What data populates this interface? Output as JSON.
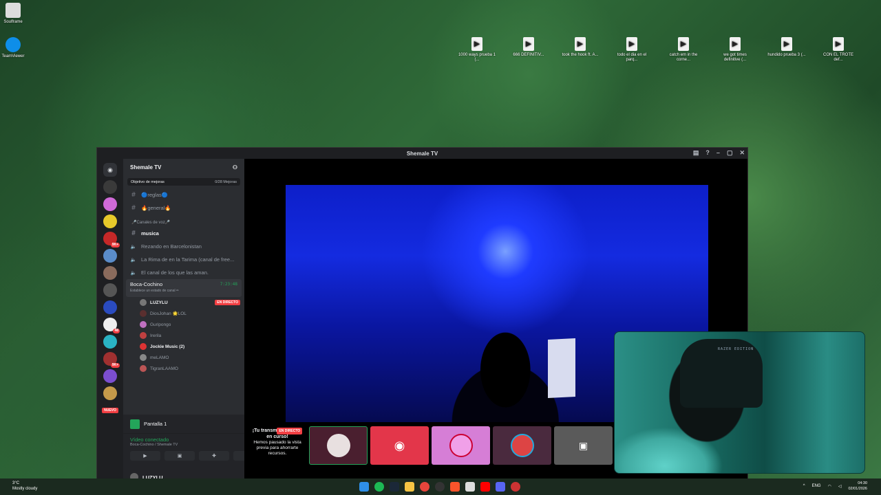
{
  "desktop": {
    "left_icons": [
      {
        "label": "Soulframe"
      },
      {
        "label": "TeamViewer"
      }
    ],
    "files": [
      {
        "label": "1000 ways prueba 1 (..."
      },
      {
        "label": "666 DEFINITIV..."
      },
      {
        "label": "took the hook ft. A..."
      },
      {
        "label": "todo el dia en el parq..."
      },
      {
        "label": "catch em in the corne..."
      },
      {
        "label": "we got times definitive (..."
      },
      {
        "label": "hundido prueba 3 (..."
      },
      {
        "label": "CON EL TROTE def..."
      }
    ]
  },
  "window": {
    "title": "Shemale TV"
  },
  "server": {
    "name": "Shemale TV",
    "boost_label": "Objetivo de mejoras",
    "boost_progress": "0/28 Mejoras",
    "server_badges": [
      "",
      "",
      "",
      "9K+",
      "",
      "",
      "",
      "",
      "",
      "48",
      "",
      "9K+",
      "",
      "56",
      "9"
    ],
    "new_label": "NUEVO"
  },
  "channels": {
    "text": [
      {
        "name": "🔵reglas🔵"
      },
      {
        "name": "🔥general🔥"
      }
    ],
    "voice_category": "🎤Canales de voz🎤",
    "voice": [
      {
        "name": "musica",
        "bright": true
      },
      {
        "name": "Rezando en Barcelonistan"
      },
      {
        "name": "La Rima de en la Tarima (canal de free..."
      },
      {
        "name": "El canal de los que las aman."
      }
    ],
    "active": {
      "name": "Boca-Cochino",
      "status": "Establece un estado de canal ✏",
      "timer": "7:23:48"
    },
    "members": [
      {
        "name": "LUZYLU",
        "bold": true,
        "live": "EN DIRECTO"
      },
      {
        "name": "DiosJohan 🌟LOL"
      },
      {
        "name": "Guripongo"
      },
      {
        "name": "Irerila"
      },
      {
        "name": "Jockie Music (2)",
        "bold": true
      },
      {
        "name": "meLAMO"
      },
      {
        "name": "TigranLAAMO"
      }
    ]
  },
  "voice_panel": {
    "screen_label": "Pantalla 1",
    "status": "Vídeo conectado",
    "location": "Boca-Cochino / Shemale TV",
    "user": "LUZYLU"
  },
  "stream": {
    "paused_title": "¡Tu transm",
    "live_badge": "EN DIRECTO",
    "paused_title2": "en curso!",
    "paused_body": "Hemos pausado la vista previa para ahorrarte recursos."
  },
  "taskbar": {
    "weather_temp": "3°C",
    "weather_text": "Mostly cloudy",
    "lang": "ENG",
    "time": "04:30",
    "date": "02/01/2026"
  },
  "cam": {
    "brand": "RAZER EDITION"
  }
}
